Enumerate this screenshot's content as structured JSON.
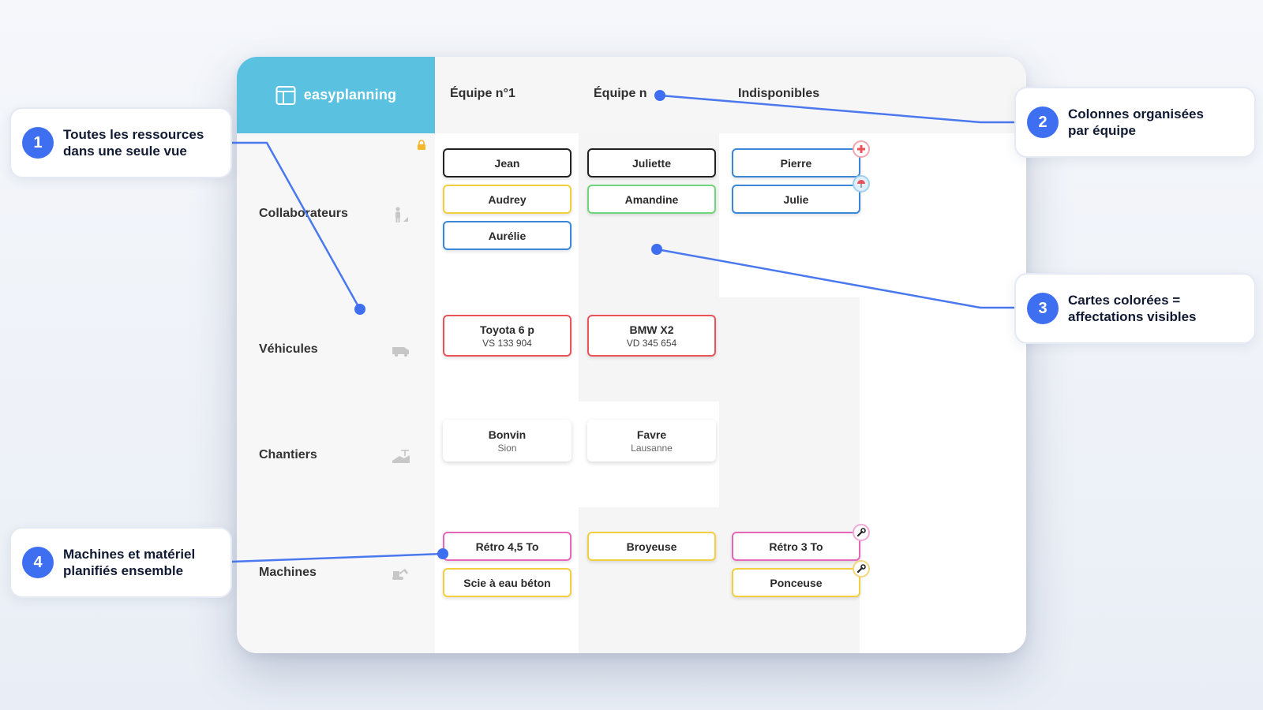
{
  "app": {
    "logo": {
      "text": "easyplanning"
    },
    "columns": [
      "Équipe n°1",
      "Équipe n",
      "Indisponibles"
    ],
    "rows": [
      "Collaborateurs",
      "Véhicules",
      "Chantiers",
      "Machines"
    ]
  },
  "cards": {
    "jean": {
      "title": "Jean"
    },
    "juliette": {
      "title": "Juliette"
    },
    "pierre": {
      "title": "Pierre"
    },
    "audrey": {
      "title": "Audrey"
    },
    "amandine": {
      "title": "Amandine"
    },
    "julie": {
      "title": "Julie"
    },
    "aurelie": {
      "title": "Aurélie"
    },
    "toyota": {
      "title": "Toyota 6 p",
      "subtitle": "VS 133 904"
    },
    "bmw": {
      "title": "BMW X2",
      "subtitle": "VD 345 654"
    },
    "bonvin": {
      "title": "Bonvin",
      "subtitle": "Sion"
    },
    "favre": {
      "title": "Favre",
      "subtitle": "Lausanne"
    },
    "retro45": {
      "title": "Rétro 4,5 To"
    },
    "broyeuse": {
      "title": "Broyeuse"
    },
    "retro3": {
      "title": "Rétro 3 To"
    },
    "scie": {
      "title": "Scie à eau béton"
    },
    "ponceuse": {
      "title": "Ponceuse"
    }
  },
  "colors": {
    "black": "#222222",
    "yellow": "#f3cf3f",
    "green": "#6fd57a",
    "blue": "#3a86d8",
    "red": "#e8545a",
    "pink": "#e766b8",
    "accent": "#3d6ff0",
    "logo_bg": "#5bc1e0"
  },
  "callouts": [
    {
      "number": "1",
      "line1": "Toutes les ressources",
      "line2": "dans une seule vue"
    },
    {
      "number": "2",
      "line1": "Colonnes organisées",
      "line2": "par équipe"
    },
    {
      "number": "3",
      "line1": "Cartes colorées =",
      "line2": "affectations visibles"
    },
    {
      "number": "4",
      "line1": "Machines et matériel",
      "line2": "planifiés ensemble"
    }
  ]
}
